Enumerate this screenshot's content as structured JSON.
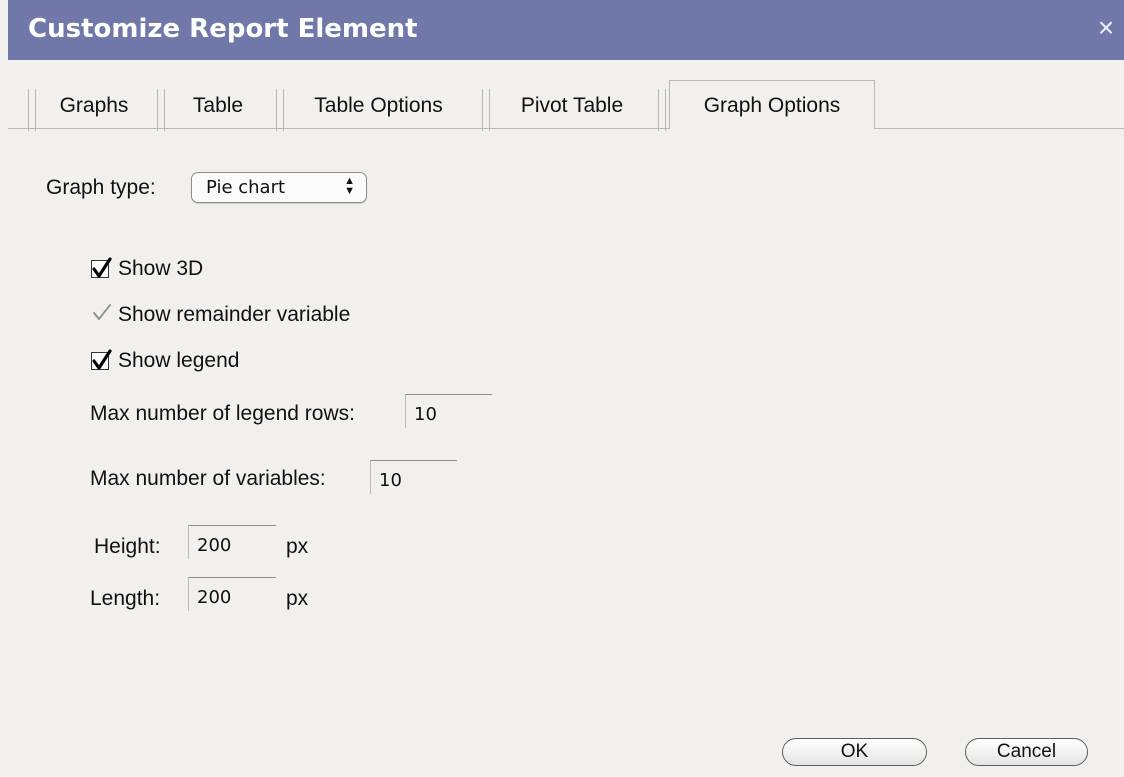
{
  "window": {
    "title": "Customize Report Element",
    "close_glyph": "×"
  },
  "tabs": [
    {
      "label": "Graphs",
      "active": false
    },
    {
      "label": "Table",
      "active": false
    },
    {
      "label": "Table Options",
      "active": false
    },
    {
      "label": "Pivot Table",
      "active": false
    },
    {
      "label": "Graph Options",
      "active": true
    }
  ],
  "graph_type": {
    "label": "Graph type:",
    "selected": "Pie chart"
  },
  "options": {
    "show_3d": {
      "label": "Show 3D",
      "checked": true
    },
    "show_remainder": {
      "label": "Show remainder variable",
      "checked": true,
      "disabled": true
    },
    "show_legend": {
      "label": "Show legend",
      "checked": true
    }
  },
  "fields": {
    "max_legend_rows": {
      "label": "Max number of legend rows:",
      "value": "10"
    },
    "max_variables": {
      "label": "Max number of variables:",
      "value": "10"
    },
    "height": {
      "label": "Height:",
      "value": "200",
      "unit": "px"
    },
    "length": {
      "label": "Length:",
      "value": "200",
      "unit": "px"
    }
  },
  "buttons": {
    "ok": "OK",
    "cancel": "Cancel"
  },
  "colors": {
    "titlebar": "#6f78a8",
    "background": "#f1f0ec"
  },
  "icons": {
    "close": "close-icon",
    "select_arrows": "updown-arrows-icon",
    "check": "checkmark-icon"
  }
}
